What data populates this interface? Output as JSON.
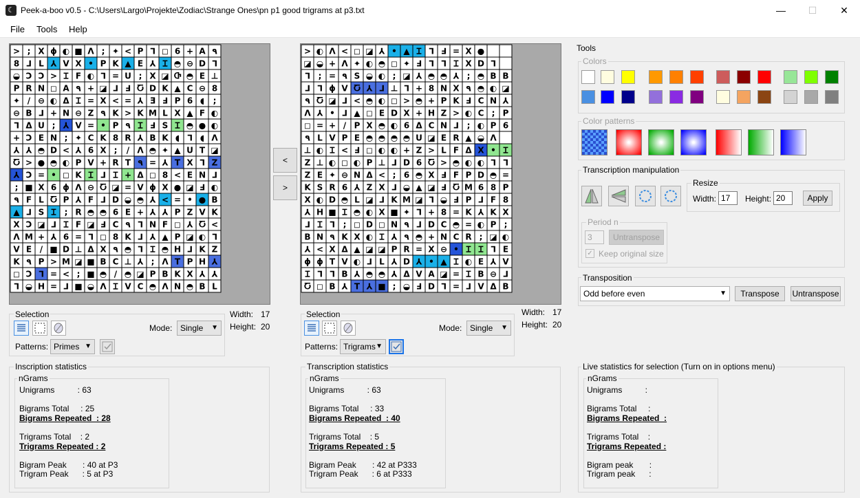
{
  "window": {
    "title": "Peek-a-boo v0.5 - C:\\Users\\Largo\\Projekte\\Zodiac\\Strange Ones\\pn p1 good trigrams at p3.txt",
    "minimize": "—",
    "maximize": "☐",
    "close": "✕"
  },
  "menu": [
    "File",
    "Tools",
    "Help"
  ],
  "nav": {
    "prev": "<",
    "next": ">"
  },
  "left": {
    "width_label": "Width:",
    "width": "17",
    "height_label": "Height:",
    "height": "20",
    "selection": {
      "title": "Selection",
      "mode_label": "Mode:",
      "mode": "Single",
      "patterns_label": "Patterns:",
      "pattern": "Primes"
    },
    "stats_title": "Inscription statistics",
    "ngrams_title": "nGrams",
    "stats": [
      {
        "text": "Unigrams          : 63",
        "u": false
      },
      {
        "text": "",
        "u": false
      },
      {
        "text": "Bigrams Total     : 25",
        "u": false
      },
      {
        "text": "Bigrams Repeated  : 28",
        "u": true
      },
      {
        "text": "",
        "u": false
      },
      {
        "text": "Trigrams Total    : 2",
        "u": false
      },
      {
        "text": "Trigrams Repeated : 2",
        "u": true
      },
      {
        "text": "",
        "u": false
      },
      {
        "text": "Bigram Peak       : 40 at P3",
        "u": false
      },
      {
        "text": "Trigram Peak      : 5 at P3",
        "u": false
      }
    ]
  },
  "right": {
    "width_label": "Width:",
    "width": "17",
    "height_label": "Height:",
    "height": "20",
    "selection": {
      "title": "Selection",
      "mode_label": "Mode:",
      "mode": "Single",
      "patterns_label": "Patterns:",
      "pattern": "Trigrams"
    },
    "stats_title": "Transcription statistics",
    "ngrams_title": "nGrams",
    "stats": [
      {
        "text": "Unigrams          : 63",
        "u": false
      },
      {
        "text": "",
        "u": false
      },
      {
        "text": "Bigrams Total     : 33",
        "u": false
      },
      {
        "text": "Bigrams Repeated  : 40",
        "u": true
      },
      {
        "text": "",
        "u": false
      },
      {
        "text": "Trigrams Total    : 5",
        "u": false
      },
      {
        "text": "Trigrams Repeated : 5",
        "u": true
      },
      {
        "text": "",
        "u": false
      },
      {
        "text": "Bigram Peak       : 42 at P333",
        "u": false
      },
      {
        "text": "Trigram Peak      : 6 at P333",
        "u": false
      }
    ]
  },
  "tools": {
    "title": "Tools",
    "colors_title": "Colors",
    "colors_row1": [
      "#ffffff",
      "#fffde0",
      "#ffff00",
      "#ff9900",
      "#ff8000",
      "#ff4000",
      "#cd5c5c",
      "#8b0000",
      "#ff0000",
      "#98e698",
      "#7fff00",
      "#008000"
    ],
    "colors_row2": [
      "#4a90e2",
      "#0000ff",
      "#00008b",
      "#9370db",
      "#8a2be2",
      "#800080",
      "#fffde0",
      "#f4a460",
      "#8b4513",
      "#d3d3d3",
      "#a9a9a9",
      "#808080"
    ],
    "color_patterns_title": "Color patterns",
    "transcription_title": "Transcription manipulation",
    "resize": {
      "title": "Resize",
      "width_label": "Width:",
      "width": "17",
      "height_label": "Height:",
      "height": "20",
      "apply": "Apply"
    },
    "period": {
      "title": "Period n",
      "value": "3",
      "untranspose": "Untranspose",
      "keep_label": "Keep original size"
    },
    "transposition": {
      "title": "Transposition",
      "option": "Odd before even",
      "transpose": "Transpose",
      "untranspose": "Untranspose"
    }
  },
  "live": {
    "title": "Live statistics for selection (Turn on in options menu)",
    "ngrams_title": "nGrams",
    "stats": [
      {
        "text": "Unigrams          :",
        "u": false
      },
      {
        "text": "",
        "u": false
      },
      {
        "text": "Bigrams Total     :",
        "u": false
      },
      {
        "text": "Bigrams Repeated  :",
        "u": true
      },
      {
        "text": "",
        "u": false
      },
      {
        "text": "Trigrams Total    :",
        "u": false
      },
      {
        "text": "Trigrams Repeated :",
        "u": true
      },
      {
        "text": "",
        "u": false
      },
      {
        "text": "Bigram peak       :",
        "u": false
      },
      {
        "text": "Trigram peak      :",
        "u": false
      }
    ]
  },
  "grids": {
    "left": {
      "rows": [
        "> ; X ɸ ◐ ■ Λ ; ✦ < P ⅂ ◻ 6 + A ٩",
        "8 ⅃ L ⅄ V X • P K ▲ E ⅄ Ɪ ◓ ⊖ D ⅂",
        "◒ Ↄ Ↄ > Ɪ F ◐ ⅂ = U ; X ◪ Ⴇ ◓ E ⊥",
        "P R N ◻ A ٩ + ◪ ⅃ Ⅎ Ⴀ D K ▲ C ⊖ 8",
        "✦ / ⊖ ◐ Δ Ɪ = X < = ⅄ Ǝ Ⅎ P 6 ◖ ;",
        "⊖ B ⅃ + N ⊖ Z ٩ K > K M L X ▲ F ◐",
        "⅂ Δ U ; ⅄ V = • P ٩ Ɪ Ⅎ S Ɪ ◓ ● ◐",
        "+ Ↄ E N ; ✦ C K 8 R ⅄ B K ◖ ⅂ ◖ Λ",
        "⅄ ⅄ ◓ D < ⅄ 6 X ; / Λ ◓ ✦ ▲ U T ◪",
        "Ⴀ > ● ◓ ◐ P V + R T ٩ = ⅄ T X ⅂ Z",
        "⅄ Ↄ = • ◻ K Ɪ ⅃ Ɪ + Δ ◻ 8 < E N ⅃",
        "; ■ X 6 ɸ Λ ⊖ Ⴀ ◪ = V ɸ X ● ◪ Ⅎ ◐",
        "٩ F L Ⴀ P ⅄ F ⅃ D ◒ ◓ ⅄ < = • ● B",
        "▲ ⅃ S Ɪ ; R ◓ ◓ 6 E + ⅄ ⅄ P Z V K",
        "X Ↄ ◪ ⅃ Ɪ F ◪ Ⅎ C ٩ ⅂ N F ◻ ⅄ Ⴀ <",
        "Λ M + ⅄ 6 = ⅂ ◻ 8 K ⅃ ⅄ ▲ P ◪ ◐ ⅂",
        "V E / ■ D ⊥ Δ X ٩ ◓ ⅂ Ɪ ◓ H ⅃ K Z",
        "K ٩ P > M ◪ ■ B C ⊥ ⅄ ; Λ T P H ⅄",
        "◻ Ↄ ⅂ = < ; ■ ◓ / ◓ ◪ P B K X ⅄ ⅄",
        "⅂ ◒ H = ⅃ ■ ◒ Λ Ɪ V C ◓ Λ N ◓ B L"
      ],
      "highlights": [
        {
          "r": 1,
          "c": 3,
          "color": "#1ab0e8"
        },
        {
          "r": 1,
          "c": 6,
          "color": "#1ab0e8"
        },
        {
          "r": 1,
          "c": 9,
          "color": "#1ab0e8"
        },
        {
          "r": 1,
          "c": 12,
          "color": "#1ab0e8"
        },
        {
          "r": 6,
          "c": 4,
          "color": "#2554d8"
        },
        {
          "r": 6,
          "c": 7,
          "color": "#90e690"
        },
        {
          "r": 6,
          "c": 10,
          "color": "#90e690"
        },
        {
          "r": 6,
          "c": 13,
          "color": "#90e690"
        },
        {
          "r": 9,
          "c": 10,
          "color": "#4a6fe0"
        },
        {
          "r": 9,
          "c": 13,
          "color": "#4a6fe0"
        },
        {
          "r": 9,
          "c": 16,
          "color": "#4a6fe0"
        },
        {
          "r": 10,
          "c": 0,
          "color": "#2554d8"
        },
        {
          "r": 10,
          "c": 3,
          "color": "#90e690"
        },
        {
          "r": 10,
          "c": 6,
          "color": "#90e690"
        },
        {
          "r": 10,
          "c": 9,
          "color": "#90e690"
        },
        {
          "r": 12,
          "c": 12,
          "color": "#1ab0e8"
        },
        {
          "r": 12,
          "c": 15,
          "color": "#1ab0e8"
        },
        {
          "r": 13,
          "c": 0,
          "color": "#1ab0e8"
        },
        {
          "r": 13,
          "c": 3,
          "color": "#1ab0e8"
        },
        {
          "r": 17,
          "c": 13,
          "color": "#4a6fe0"
        },
        {
          "r": 17,
          "c": 16,
          "color": "#4a6fe0"
        },
        {
          "r": 18,
          "c": 2,
          "color": "#4a6fe0"
        }
      ]
    },
    "right": {
      "rows": [
        "> ◐ Λ < ◻ ◪ ⅄ • ▲ Ɪ ⅂ Ⅎ = X ●",
        "◪ ◒ + Λ ✦ ◐ ◓ ◻ ✦ Ⅎ ⅂ ⅂ Ɪ X D ⅂",
        "⅂ ; = ٩ S ◒ ◐ ; ◪ ⅄ ◓ ◓ ⅄ ; ◓ B B",
        "⅃ ⅂ ɸ V Ⴀ ⅄ ⅃ ⊥ ⅂ + 8 N X ٩ ◓ ◐ ◪",
        "٩ Ⴀ ◪ ⅃ < ◓ ◐ ◻ > ◓ + P K Ⅎ C N ⅄",
        "Λ ⅄ • ⅃ ▲ ◻ E D X + H Z > ◐ C ; P",
        "◻ = + / P X ◓ ◐ 6 Δ C N ⅃ ; ◐ P 6",
        "٩ L V P E ◓ ◓ ◓ ◓ U ◪ E R ▲ ◒ Λ",
        "⊥ ◐ Ɪ < Ⅎ ◻ ◐ ◐ + Z > L F Δ X • Ɪ",
        "Z ⊥ ◐ ◻ ◐ P ⊥ ⅃ D 6 Ⴀ > ◓ ◐ ◐ ⅂ ⅂",
        "Z E ✦ ⊖ N Δ < ; 6 ◓ X Ⅎ F P D ◓ =",
        "K S R 6 ⅄ Z X ⅃ ◒ ▲ ◪ Ⅎ Ⴀ M 6 8 P",
        "X ◐ D ◓ L ◪ ⅃ K M ◪ ⅂ ◒ Ⅎ P ⅃ F 8",
        "⅄ H ■ Ɪ ◓ ◐ X ■ ✦ ⅂ + 8 = K ⅄ K X",
        "⅃ Ɪ ⅂ ; ◻ D ◻ N ٩ ⅃ D C ◓ = ◐ P ;",
        "B N ٩ K X ◐ Ɪ ⅄ ٩ ◓ + N C R ; ◪ ◐",
        "⅄ < X Δ ▲ ◪ ◪ P R = X ⊖ • Ɪ Ɪ ⅂ E",
        "ɸ ɸ T V ◐ ⅃ L ⅄ D ⅄ • ▲ Ɪ ◐ E ⅄ V",
        "Ɪ ⅂ ⅂ B ⅄ ◓ ◓ ⅄ Δ V A ◪ = Ɪ B ⊖ ⅃",
        "Ⴀ ◻ B ⅄ T ⅄ ■ ; ◒ Ⅎ D ⅂ = ⅃ V Δ B"
      ],
      "highlights": [
        {
          "r": 0,
          "c": 7,
          "color": "#1ab0e8"
        },
        {
          "r": 0,
          "c": 8,
          "color": "#1ab0e8"
        },
        {
          "r": 0,
          "c": 9,
          "color": "#1ab0e8"
        },
        {
          "r": 3,
          "c": 4,
          "color": "#4a6fe0"
        },
        {
          "r": 3,
          "c": 5,
          "color": "#4a6fe0"
        },
        {
          "r": 3,
          "c": 6,
          "color": "#4a6fe0"
        },
        {
          "r": 8,
          "c": 14,
          "color": "#2554d8"
        },
        {
          "r": 8,
          "c": 15,
          "color": "#90e690"
        },
        {
          "r": 8,
          "c": 16,
          "color": "#90e690"
        },
        {
          "r": 16,
          "c": 12,
          "color": "#2554d8"
        },
        {
          "r": 16,
          "c": 13,
          "color": "#90e690"
        },
        {
          "r": 16,
          "c": 14,
          "color": "#90e690"
        },
        {
          "r": 17,
          "c": 9,
          "color": "#1ab0e8"
        },
        {
          "r": 17,
          "c": 10,
          "color": "#1ab0e8"
        },
        {
          "r": 17,
          "c": 11,
          "color": "#1ab0e8"
        },
        {
          "r": 19,
          "c": 4,
          "color": "#4a6fe0"
        },
        {
          "r": 19,
          "c": 5,
          "color": "#4a6fe0"
        },
        {
          "r": 19,
          "c": 6,
          "color": "#4a6fe0"
        }
      ]
    }
  }
}
